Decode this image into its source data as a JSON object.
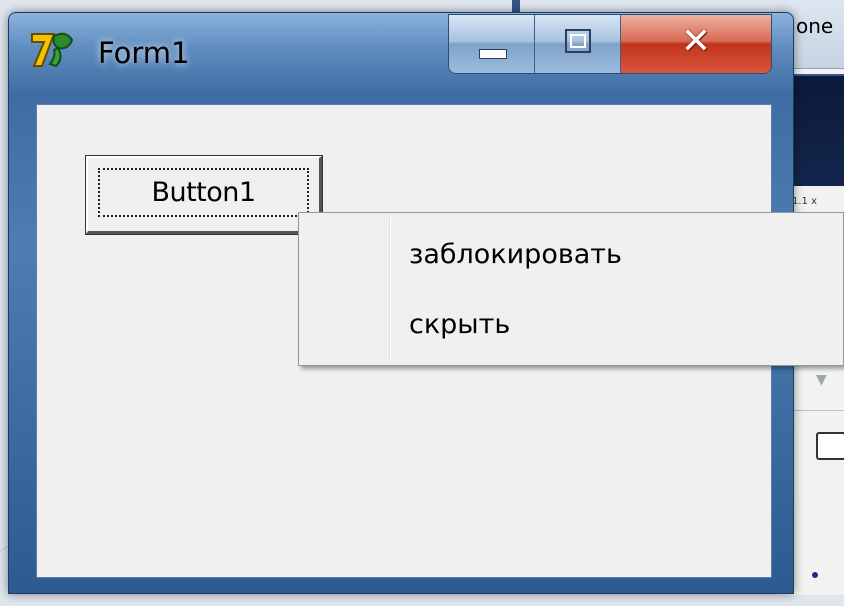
{
  "background": {
    "partial_text": "one",
    "small_text": "1.1 x"
  },
  "window": {
    "title": "Form1",
    "icon": "delphi-helmet-icon",
    "controls": {
      "minimize": "minimize-icon",
      "maximize": "maximize-icon",
      "close": "close-icon"
    }
  },
  "form": {
    "button_label": "Button1"
  },
  "context_menu": {
    "items": [
      {
        "label": "заблокировать"
      },
      {
        "label": "скрыть"
      }
    ]
  },
  "colors": {
    "title_bar": "#4e7db3",
    "client_bg": "#f0f0f0",
    "close_button": "#c2341a"
  }
}
